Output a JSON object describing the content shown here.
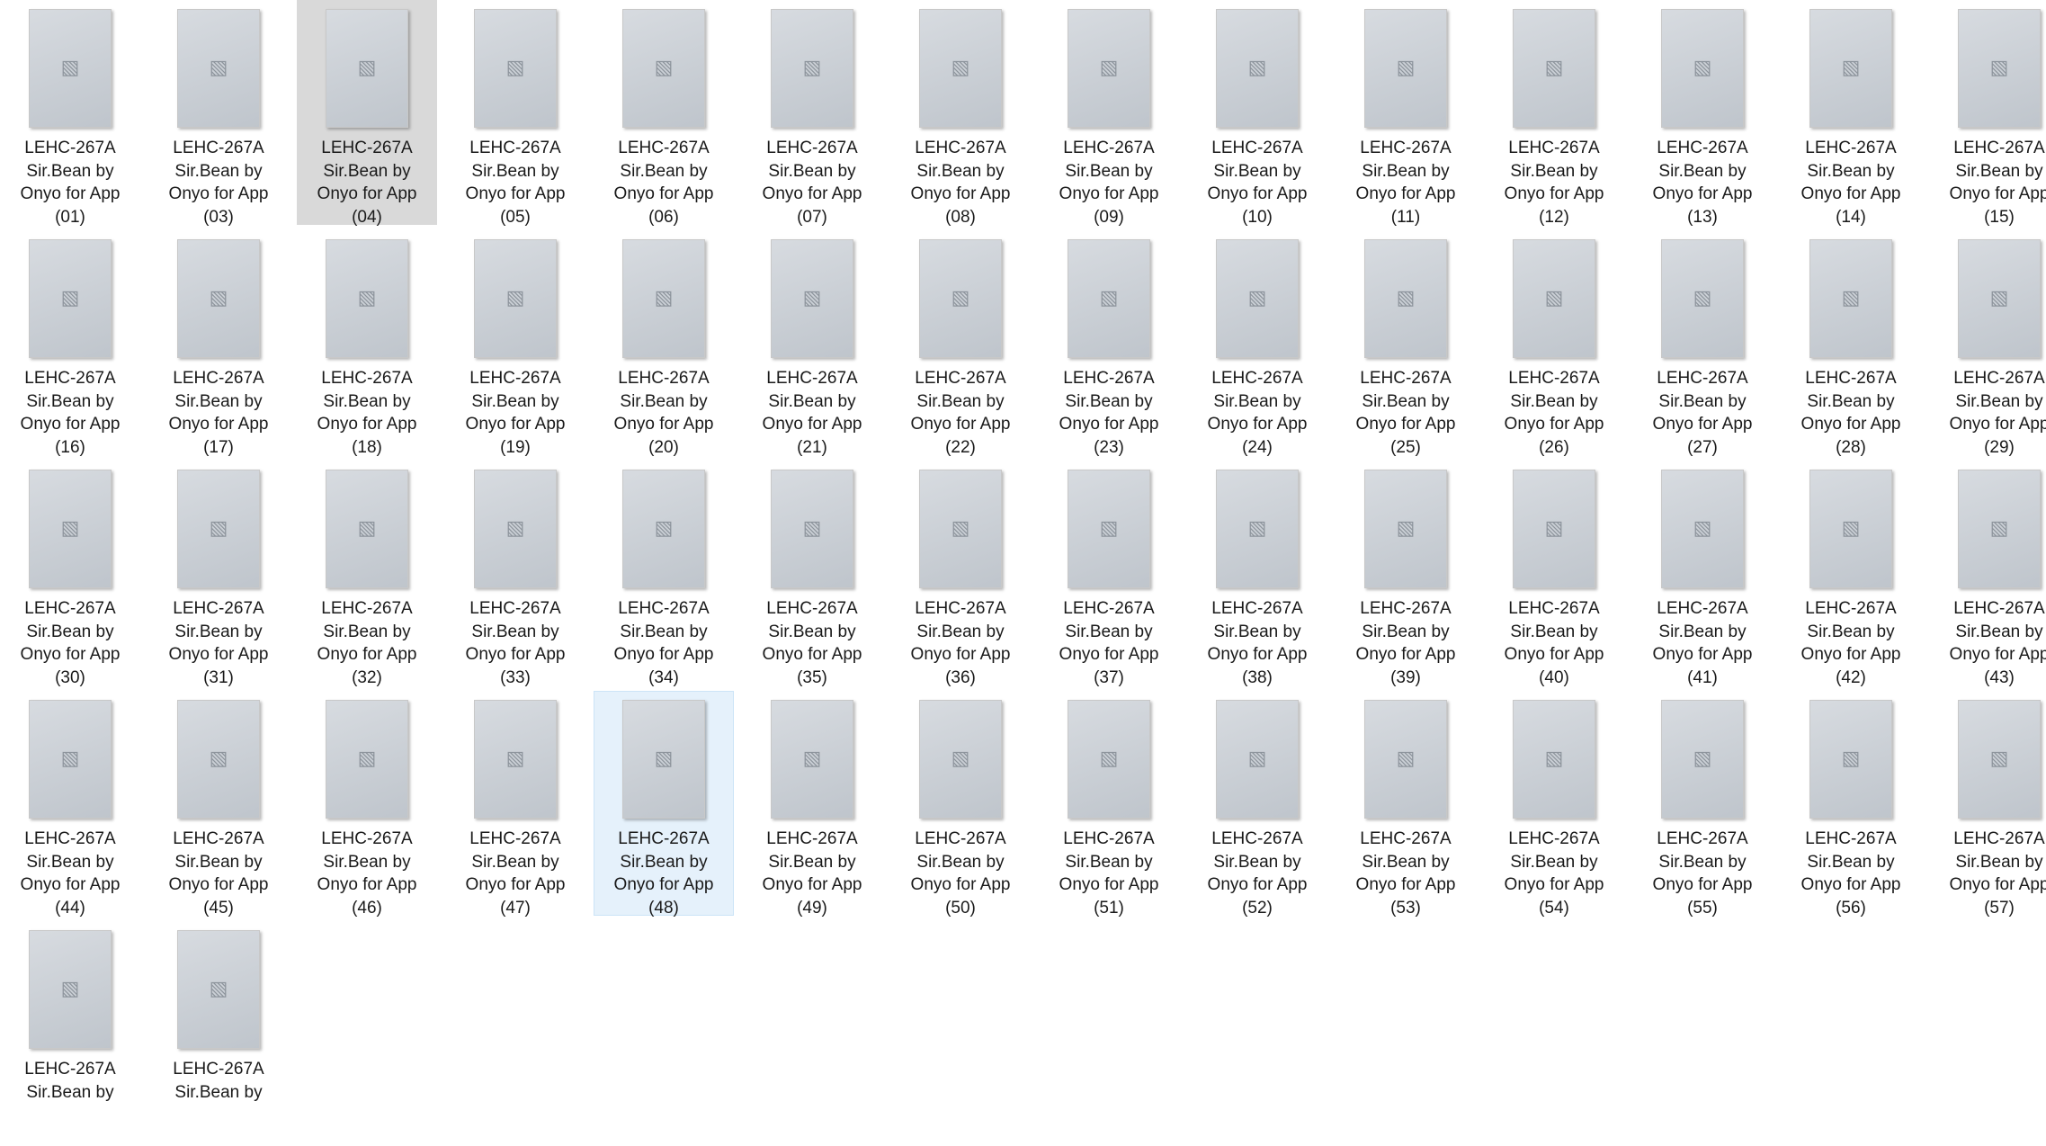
{
  "explorer": {
    "file_prefix": "LEHC-267A",
    "line2": "Sir.Bean by",
    "line3": "Onyo for App",
    "placeholder_icon": "image-icon",
    "files": [
      {
        "num": "(01)",
        "selected": ""
      },
      {
        "num": "(03)",
        "selected": ""
      },
      {
        "num": "(04)",
        "selected": "gray"
      },
      {
        "num": "(05)",
        "selected": ""
      },
      {
        "num": "(06)",
        "selected": ""
      },
      {
        "num": "(07)",
        "selected": ""
      },
      {
        "num": "(08)",
        "selected": ""
      },
      {
        "num": "(09)",
        "selected": ""
      },
      {
        "num": "(10)",
        "selected": ""
      },
      {
        "num": "(11)",
        "selected": ""
      },
      {
        "num": "(12)",
        "selected": ""
      },
      {
        "num": "(13)",
        "selected": ""
      },
      {
        "num": "(14)",
        "selected": ""
      },
      {
        "num": "(15)",
        "selected": ""
      },
      {
        "num": "(16)",
        "selected": ""
      },
      {
        "num": "(17)",
        "selected": ""
      },
      {
        "num": "(18)",
        "selected": ""
      },
      {
        "num": "(19)",
        "selected": ""
      },
      {
        "num": "(20)",
        "selected": ""
      },
      {
        "num": "(21)",
        "selected": ""
      },
      {
        "num": "(22)",
        "selected": ""
      },
      {
        "num": "(23)",
        "selected": ""
      },
      {
        "num": "(24)",
        "selected": ""
      },
      {
        "num": "(25)",
        "selected": ""
      },
      {
        "num": "(26)",
        "selected": ""
      },
      {
        "num": "(27)",
        "selected": ""
      },
      {
        "num": "(28)",
        "selected": ""
      },
      {
        "num": "(29)",
        "selected": ""
      },
      {
        "num": "(30)",
        "selected": ""
      },
      {
        "num": "(31)",
        "selected": ""
      },
      {
        "num": "(32)",
        "selected": ""
      },
      {
        "num": "(33)",
        "selected": ""
      },
      {
        "num": "(34)",
        "selected": ""
      },
      {
        "num": "(35)",
        "selected": ""
      },
      {
        "num": "(36)",
        "selected": ""
      },
      {
        "num": "(37)",
        "selected": ""
      },
      {
        "num": "(38)",
        "selected": ""
      },
      {
        "num": "(39)",
        "selected": ""
      },
      {
        "num": "(40)",
        "selected": ""
      },
      {
        "num": "(41)",
        "selected": ""
      },
      {
        "num": "(42)",
        "selected": ""
      },
      {
        "num": "(43)",
        "selected": ""
      },
      {
        "num": "(44)",
        "selected": ""
      },
      {
        "num": "(45)",
        "selected": ""
      },
      {
        "num": "(46)",
        "selected": ""
      },
      {
        "num": "(47)",
        "selected": ""
      },
      {
        "num": "(48)",
        "selected": "blue"
      },
      {
        "num": "(49)",
        "selected": ""
      },
      {
        "num": "(50)",
        "selected": ""
      },
      {
        "num": "(51)",
        "selected": ""
      },
      {
        "num": "(52)",
        "selected": ""
      },
      {
        "num": "(53)",
        "selected": ""
      },
      {
        "num": "(54)",
        "selected": ""
      },
      {
        "num": "(55)",
        "selected": ""
      },
      {
        "num": "(56)",
        "selected": ""
      },
      {
        "num": "(57)",
        "selected": ""
      },
      {
        "num": "",
        "selected": ""
      },
      {
        "num": "",
        "selected": ""
      }
    ]
  },
  "colors": {
    "selection_gray": "#d9d9d9",
    "selection_blue": "#e5f1fb",
    "selection_blue_border": "#cce4f7",
    "text": "#1a1a1a"
  }
}
